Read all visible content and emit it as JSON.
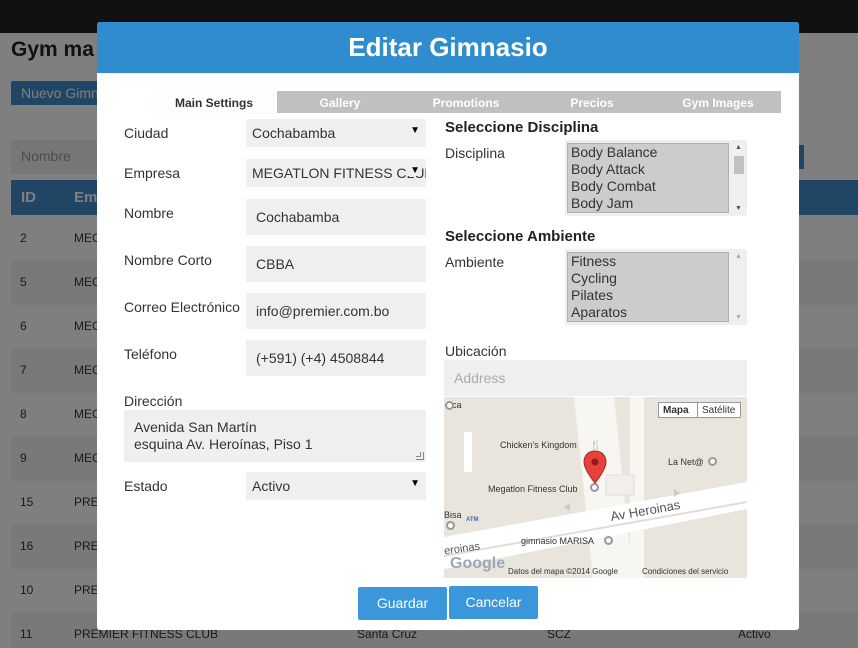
{
  "background": {
    "page_title": "Gym ma",
    "new_button": "Nuevo Gimn",
    "filter_placeholder": "Nombre",
    "table_headers": [
      "ID",
      "Em"
    ],
    "rows": [
      {
        "id": "2",
        "empresa": "MEG"
      },
      {
        "id": "5",
        "empresa": "MEG"
      },
      {
        "id": "6",
        "empresa": "MEG"
      },
      {
        "id": "7",
        "empresa": "MEG"
      },
      {
        "id": "8",
        "empresa": "MEG"
      },
      {
        "id": "9",
        "empresa": "MEG"
      },
      {
        "id": "15",
        "empresa": "PRE"
      },
      {
        "id": "16",
        "empresa": "PRE"
      },
      {
        "id": "10",
        "empresa": "PRE"
      },
      {
        "id": "11",
        "empresa": "PREMIER FITNESS CLUB",
        "ciudad": "Santa Cruz",
        "corto": "SCZ",
        "estado": "Activo"
      }
    ]
  },
  "modal": {
    "title": "Editar Gimnasio",
    "tabs": [
      {
        "label": "Main Settings",
        "active": true
      },
      {
        "label": "Gallery",
        "active": false
      },
      {
        "label": "Promotions",
        "active": false
      },
      {
        "label": "Precios",
        "active": false
      },
      {
        "label": "Gym Images",
        "active": false
      }
    ],
    "form": {
      "ciudad_label": "Ciudad",
      "ciudad_value": "Cochabamba",
      "empresa_label": "Empresa",
      "empresa_value": "MEGATLON FITNESS CLUB",
      "nombre_label": "Nombre",
      "nombre_value": "Cochabamba",
      "nombre_corto_label": "Nombre Corto",
      "nombre_corto_value": "CBBA",
      "correo_label": "Correo Electrónico",
      "correo_value": "info@premier.com.bo",
      "telefono_label": "Teléfono",
      "telefono_value": "(+591) (+4) 4508844",
      "direccion_label": "Dirección",
      "direccion_line1": "Avenida San Martín",
      "direccion_line2": "esquina Av. Heroínas, Piso 1",
      "estado_label": "Estado",
      "estado_value": "Activo"
    },
    "disciplina": {
      "section_title": "Seleccione Disciplina",
      "label": "Disciplina",
      "options": [
        "Body Balance",
        "Body Attack",
        "Body Combat",
        "Body Jam"
      ]
    },
    "ambiente": {
      "section_title": "Seleccione Ambiente",
      "label": "Ambiente",
      "options": [
        "Fitness",
        "Cycling",
        "Pilates",
        "Aparatos"
      ]
    },
    "ubicacion": {
      "label": "Ubicación",
      "address_placeholder": "Address",
      "map": {
        "type_map": "Mapa",
        "type_satellite": "Satélite",
        "places": [
          "Chicken's Kingdom",
          "La Net@",
          "Megatlon Fitness Club",
          "Av Heroinas",
          "gimnasio MARISA",
          "Bisa",
          "eroinas",
          "ca"
        ],
        "attribution": "Datos del mapa ©2014 Google",
        "terms": "Condiciones del servicio",
        "logo": "Google"
      }
    },
    "buttons": {
      "save": "Guardar",
      "cancel": "Cancelar"
    }
  },
  "colors": {
    "header": "#2f8ccf",
    "button": "#3a97dc",
    "tab_inactive": "#c0c0c0",
    "field_bg": "#eef0f0",
    "table_header": "#428bca",
    "marker": "#e8403a"
  }
}
